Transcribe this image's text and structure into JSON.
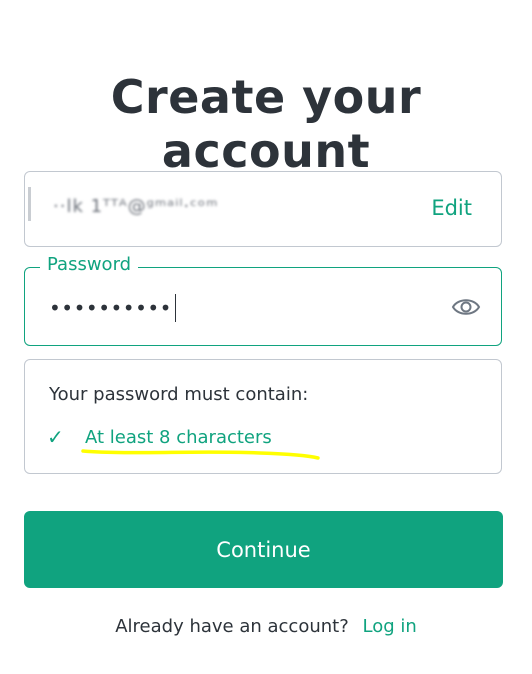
{
  "title": "Create your account",
  "email": {
    "value": "··lk 1ᵀᵀᴬ@ᵍᵐᵃⁱˡ·ᶜᵒᵐ",
    "edit_label": "Edit"
  },
  "password": {
    "label": "Password",
    "value": "••••••••••",
    "toggle_icon": "eye-icon"
  },
  "requirements": {
    "heading": "Your password must contain:",
    "items": [
      {
        "icon": "check-icon",
        "check_glyph": "✓",
        "text": "At least 8 characters",
        "met": true
      }
    ]
  },
  "continue_label": "Continue",
  "login_prompt": {
    "text": "Already have an account?",
    "link": "Log in"
  },
  "colors": {
    "accent": "#10a37f",
    "text": "#2d333a",
    "border": "#c2c8d0",
    "highlight_underline": "#ffff00"
  }
}
